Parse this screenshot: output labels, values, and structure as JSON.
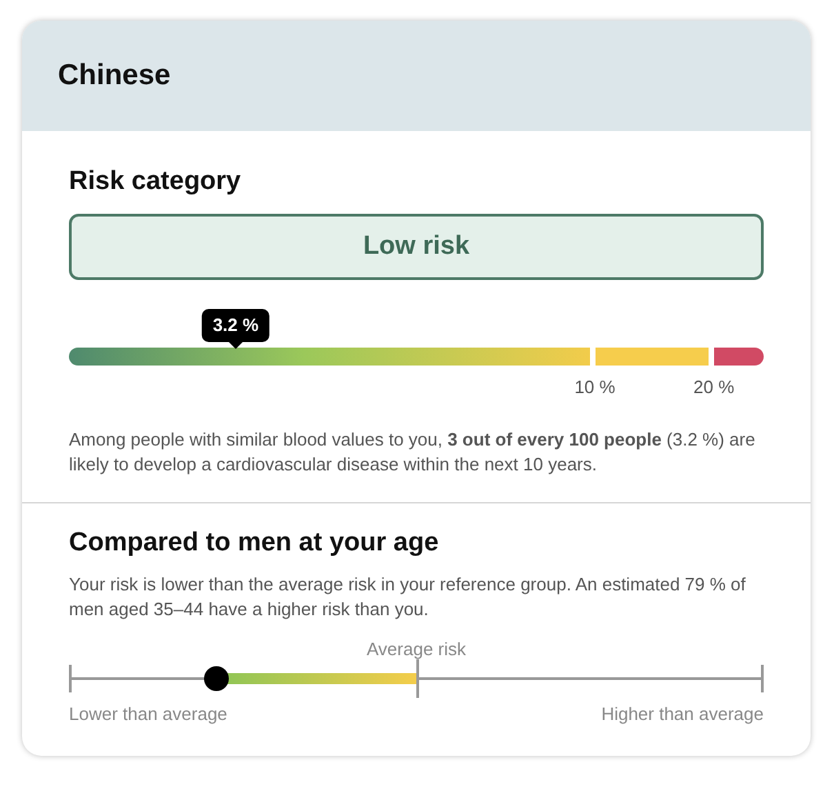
{
  "header": {
    "title": "Chinese"
  },
  "risk": {
    "title": "Risk category",
    "category": "Low risk",
    "marker": "3.2 %",
    "level": 0.24,
    "ticks": [
      "10 %",
      "20 %"
    ],
    "description": "Among people with similar blood values to you, **3 out of every 100 people** (3.2 %) are likely to develop a cardiovascular disease within the next 10 years."
  },
  "comparison": {
    "title": "Compared to men at your age",
    "description": "Your risk is lower than the average risk in your reference group. An estimated 79 % of men aged 35–44 have a higher risk than you.",
    "average_label": "Average risk",
    "level": 0.21,
    "low_label": "Lower than average",
    "high_label": "Higher than average"
  }
}
